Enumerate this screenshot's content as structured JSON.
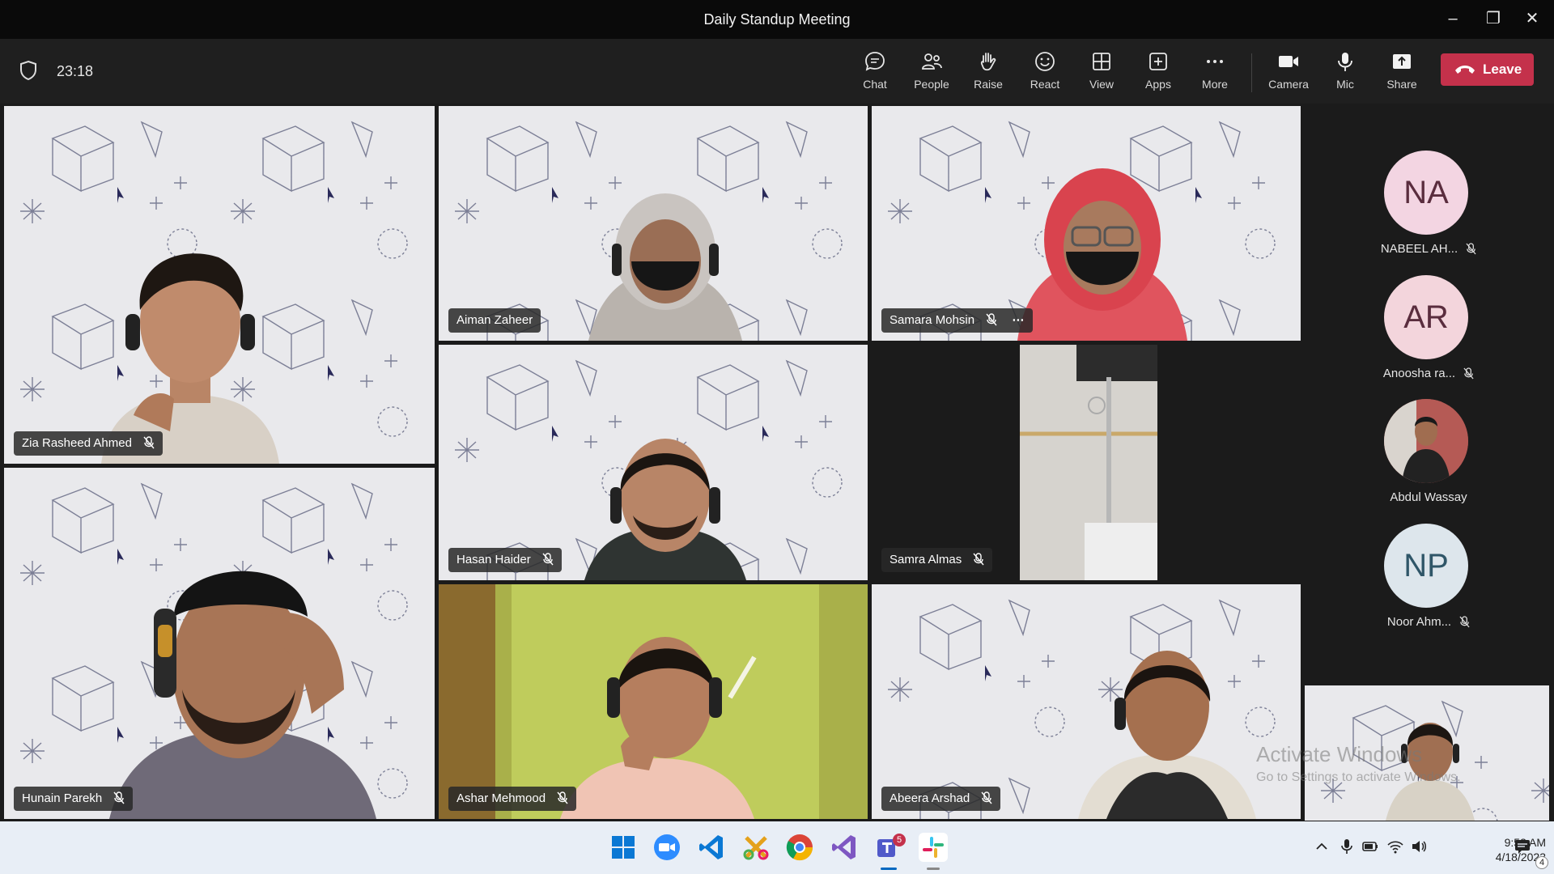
{
  "window": {
    "title": "Daily Standup Meeting",
    "minimize_icon": "minimize-icon",
    "restore_icon": "restore-icon",
    "close_icon": "close-icon"
  },
  "toolbar": {
    "timer": "23:18",
    "buttons": [
      {
        "label": "Chat",
        "icon": "chat-icon"
      },
      {
        "label": "People",
        "icon": "people-icon"
      },
      {
        "label": "Raise",
        "icon": "raise-hand-icon"
      },
      {
        "label": "React",
        "icon": "react-icon"
      },
      {
        "label": "View",
        "icon": "view-icon"
      },
      {
        "label": "Apps",
        "icon": "apps-icon"
      },
      {
        "label": "More",
        "icon": "more-icon"
      },
      {
        "label": "Camera",
        "icon": "camera-icon"
      },
      {
        "label": "Mic",
        "icon": "mic-icon"
      },
      {
        "label": "Share",
        "icon": "share-icon"
      }
    ],
    "leave_label": "Leave"
  },
  "participants": {
    "zia": "Zia Rasheed Ahmed",
    "aiman": "Aiman Zaheer",
    "samara": "Samara Mohsin",
    "hasan": "Hasan Haider",
    "samra": "Samra Almas",
    "hunain": "Hunain Parekh",
    "ashar": "Ashar Mehmood",
    "abeera": "Abeera Arshad"
  },
  "roster": [
    {
      "initials": "NA",
      "name": "NABEEL AH...",
      "color": "#f3d5e2"
    },
    {
      "initials": "AR",
      "name": "Anoosha ra...",
      "color": "#f3d5dc"
    },
    {
      "initials": "",
      "name": "Abdul Wassay",
      "color": "#8d4b4b"
    },
    {
      "initials": "NP",
      "name": "Noor Ahm...",
      "color": "#dde6ec"
    }
  ],
  "watermark": {
    "line1": "Activate Windows",
    "line2": "Go to Settings to activate Windows."
  },
  "taskbar": {
    "time": "9:53 AM",
    "date": "4/18/2023",
    "teams_badge": "5",
    "notifications": "4"
  },
  "colors": {
    "accent": "#7b83eb",
    "leave": "#c4314b"
  }
}
